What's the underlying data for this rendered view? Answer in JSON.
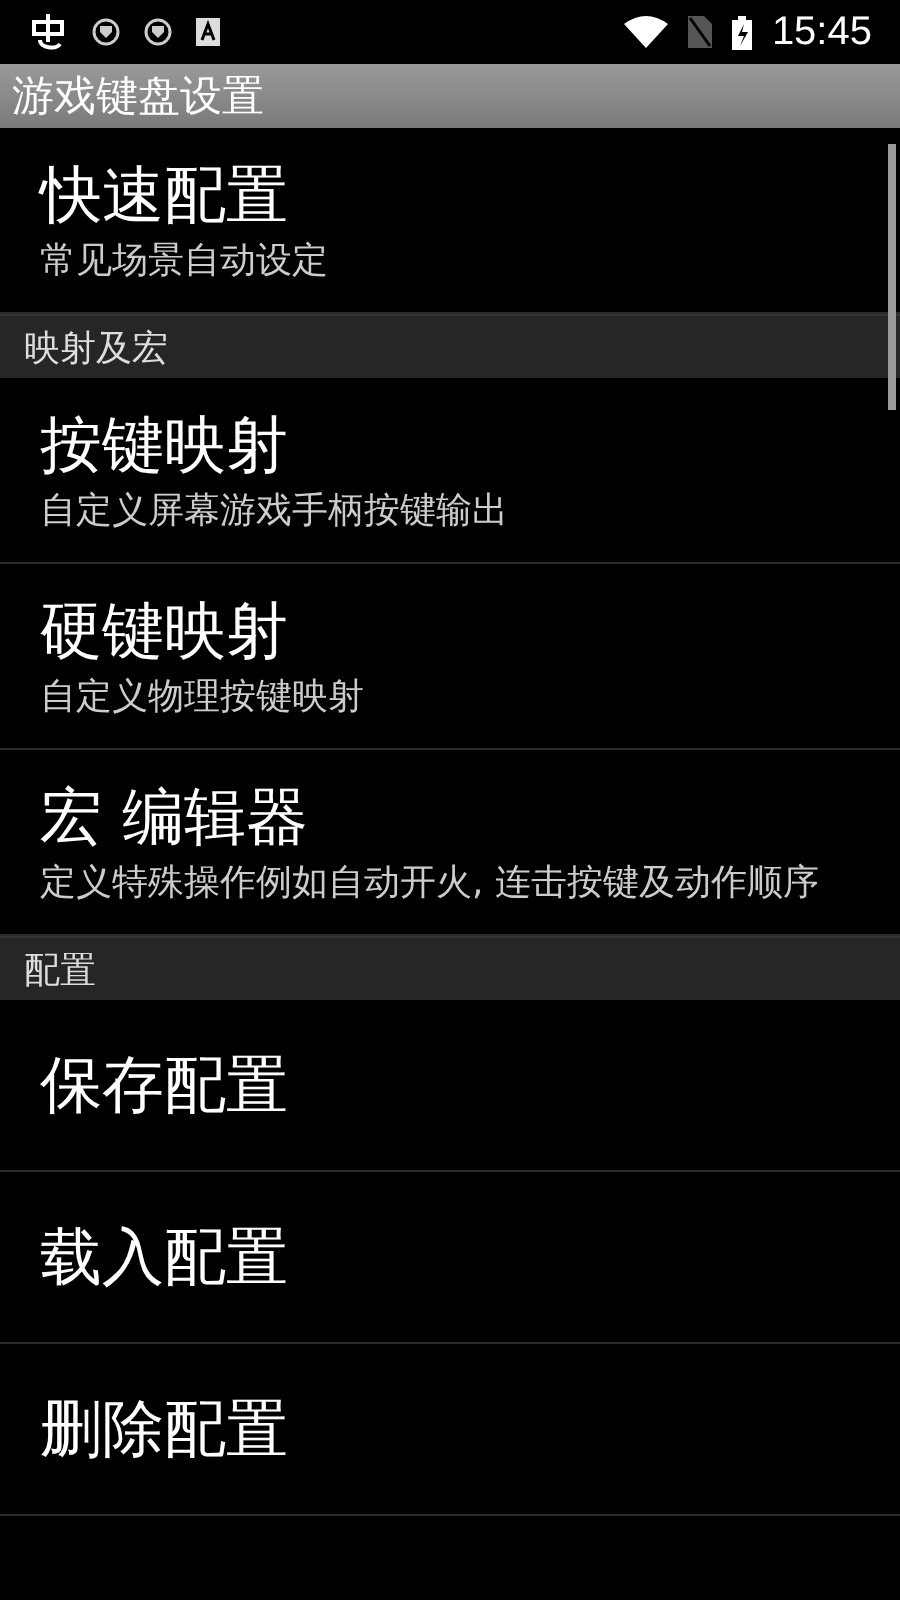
{
  "status_bar": {
    "time": "15:45"
  },
  "title_bar": {
    "title": "游戏键盘设置"
  },
  "list": [
    {
      "kind": "item",
      "title": "快速配置",
      "summary": "常见场景自动设定"
    },
    {
      "kind": "header",
      "title": "映射及宏"
    },
    {
      "kind": "item",
      "title": "按键映射",
      "summary": "自定义屏幕游戏手柄按键输出"
    },
    {
      "kind": "item",
      "title": "硬键映射",
      "summary": "自定义物理按键映射"
    },
    {
      "kind": "item",
      "title": "宏 编辑器",
      "summary": "定义特殊操作例如自动开火, 连击按键及动作顺序"
    },
    {
      "kind": "header",
      "title": "配置"
    },
    {
      "kind": "item",
      "title": "保存配置"
    },
    {
      "kind": "item",
      "title": "载入配置"
    },
    {
      "kind": "item",
      "title": "删除配置"
    }
  ]
}
